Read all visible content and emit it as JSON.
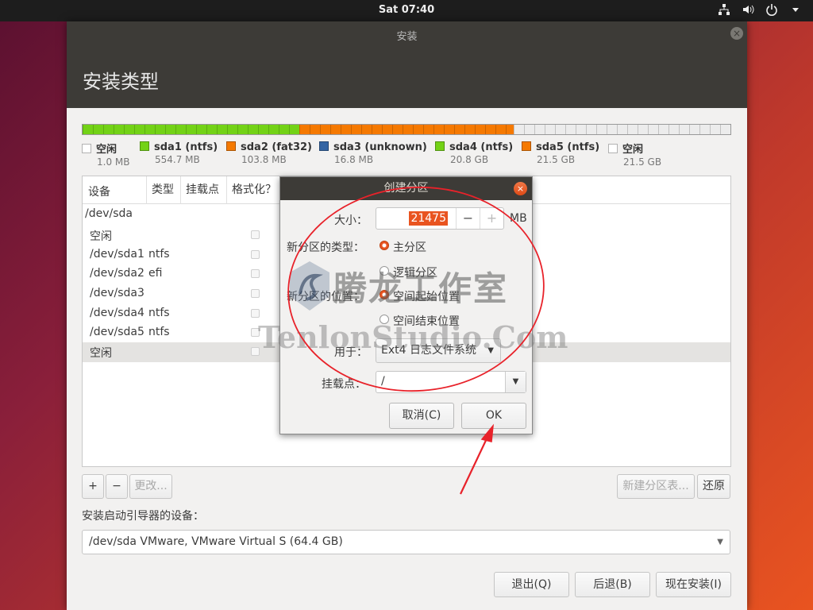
{
  "topbar": {
    "clock": "Sat 07:40",
    "icons": [
      "network-icon",
      "volume-icon",
      "power-icon",
      "chevron-down-icon"
    ]
  },
  "window": {
    "title": "安装",
    "heading": "安装类型",
    "close_glyph": "×"
  },
  "partition_bar": {
    "segments": [
      {
        "name": "空闲",
        "color": "#f2f2f2",
        "fraction": 0.0
      },
      {
        "name": "sda1",
        "color": "#73d216",
        "fraction": 0.334
      },
      {
        "name": "sda2",
        "color": "#f57900",
        "fraction": 0.332
      },
      {
        "name": "free",
        "color": "#ececec",
        "fraction": 0.334
      }
    ],
    "legend": [
      {
        "name": "空闲",
        "size": "1.0 MB",
        "color": "#ffffff"
      },
      {
        "name": "sda1 (ntfs)",
        "size": "554.7 MB",
        "color": "#73d216"
      },
      {
        "name": "sda2 (fat32)",
        "size": "103.8 MB",
        "color": "#f57900"
      },
      {
        "name": "sda3 (unknown)",
        "size": "16.8 MB",
        "color": "#3465a4"
      },
      {
        "name": "sda4 (ntfs)",
        "size": "20.8 GB",
        "color": "#73d216"
      },
      {
        "name": "sda5 (ntfs)",
        "size": "21.5 GB",
        "color": "#f57900"
      },
      {
        "name": "空闲",
        "size": "21.5 GB",
        "color": "#ffffff"
      }
    ]
  },
  "table": {
    "headers": [
      "设备",
      "类型",
      "挂载点",
      "格式化？"
    ],
    "rows": [
      {
        "device": "/dev/sda",
        "type": ""
      },
      {
        "device": "空闲",
        "type": ""
      },
      {
        "device": "/dev/sda1",
        "type": "ntfs"
      },
      {
        "device": "/dev/sda2",
        "type": "efi"
      },
      {
        "device": "/dev/sda3",
        "type": ""
      },
      {
        "device": "/dev/sda4",
        "type": "ntfs"
      },
      {
        "device": "/dev/sda5",
        "type": "ntfs"
      },
      {
        "device": "空闲",
        "type": ""
      }
    ]
  },
  "table_buttons": {
    "add": "+",
    "remove": "−",
    "change": "更改...",
    "new_table": "新建分区表...",
    "revert": "还原"
  },
  "boot": {
    "label": "安装启动引导器的设备：",
    "value": "/dev/sda   VMware, VMware Virtual S (64.4 GB)"
  },
  "footer": {
    "quit": "退出(Q)",
    "back": "后退(B)",
    "install": "现在安装(I)"
  },
  "dialog": {
    "title": "创建分区",
    "close_glyph": "×",
    "size_label": "大小：",
    "size_value": "21475",
    "size_unit": "MB",
    "minus": "−",
    "plus": "+",
    "type_label": "新分区的类型：",
    "type_primary": "主分区",
    "type_logical": "逻辑分区",
    "location_label": "新分区的位置：",
    "location_start": "空间起始位置",
    "location_end": "空间结束位置",
    "use_label": "用于：",
    "use_value": "Ext4 日志文件系统",
    "mount_label": "挂载点：",
    "mount_value": "/",
    "cancel": "取消(C)",
    "ok": "OK"
  },
  "watermark": {
    "cn": "腾龙工作室",
    "en": "TenlonStudio.Com"
  },
  "colors": {
    "accent": "#e95420",
    "annotation": "#e8222a"
  }
}
